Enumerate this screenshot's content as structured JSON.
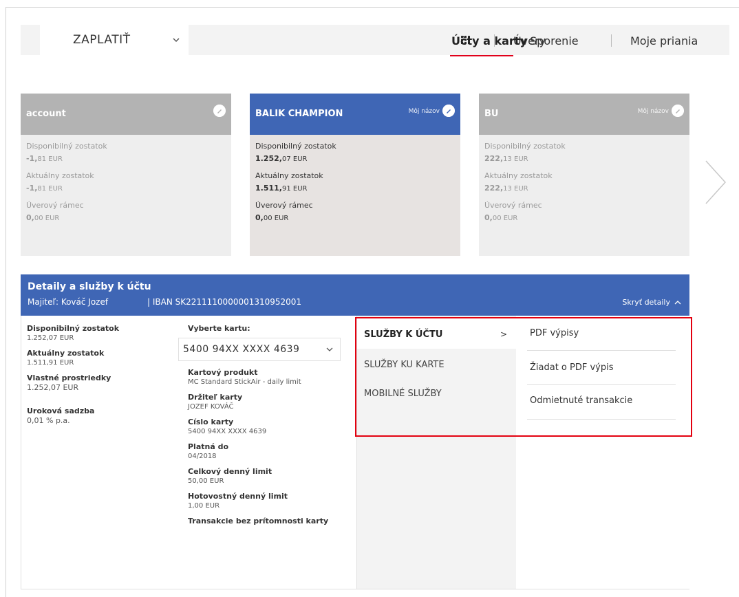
{
  "topbar": {
    "pay_label": "ZAPLATIŤ",
    "nav": [
      {
        "label": "Úvery"
      },
      {
        "label": "Účty a karty",
        "active": true
      },
      {
        "label": "Sporenie"
      },
      {
        "label": "Moje priania"
      }
    ]
  },
  "cards": [
    {
      "title": "account",
      "my_name": "",
      "available_label": "Disponibilný zostatok",
      "available_int": "-1,",
      "available_dec": "81 EUR",
      "current_label": "Aktuálny zostatok",
      "current_int": "-1,",
      "current_dec": "81 EUR",
      "credit_label": "Úverový rámec",
      "credit_int": "0,",
      "credit_dec": "00 EUR"
    },
    {
      "title": "BALIK CHAMPION",
      "my_name": "Môj názov",
      "available_label": "Disponibilný zostatok",
      "available_int": "1.252,",
      "available_dec": "07 EUR",
      "current_label": "Aktuálny zostatok",
      "current_int": "1.511,",
      "current_dec": "91 EUR",
      "credit_label": "Úverový rámec",
      "credit_int": "0,",
      "credit_dec": "00 EUR"
    },
    {
      "title": "BU",
      "my_name": "Môj názov",
      "available_label": "Disponibilný zostatok",
      "available_int": "222,",
      "available_dec": "13 EUR",
      "current_label": "Aktuálny zostatok",
      "current_int": "222,",
      "current_dec": "13 EUR",
      "credit_label": "Úverový rámec",
      "credit_int": "0,",
      "credit_dec": "00 EUR"
    }
  ],
  "detail": {
    "title": "Detaily a služby k účtu",
    "owner": "Majiteľ: Kováč Jozef",
    "iban": "| IBAN SK2211110000001310952001",
    "hide_label": "Skryť detaily",
    "account": {
      "available_label": "Disponibilný zostatok",
      "available_value": "1.252,07 EUR",
      "current_label": "Aktuálny zostatok",
      "current_value": "1.511,91 EUR",
      "own_label": "Vlastné prostriedky",
      "own_value": "1.252,07 EUR",
      "rate_label": "Uroková sadzba",
      "rate_value": "0,01 % p.a."
    },
    "card": {
      "select_label": "Vyberte kartu:",
      "select_value": "5400 94XX XXXX 4639",
      "product_label": "Kartový produkt",
      "product_value": "MC Standard StickAir - daily limit",
      "holder_label": "Držiteľ karty",
      "holder_value": "JOZEF KOVÁČ",
      "number_label": "Císlo karty",
      "number_value": "5400 94XX XXXX 4639",
      "valid_label": "Platná do",
      "valid_value": "04/2018",
      "daily_label": "Celkový denný limit",
      "daily_value": "50,00 EUR",
      "cash_label": "Hotovostný denný limit",
      "cash_value": "1,00 EUR",
      "cnp_label": "Transakcie bez prítomnosti karty"
    },
    "services": {
      "tabs": [
        "SLUŽBY K ÚČTU",
        "SLUŽBY KU KARTE",
        "MOBILNÉ SLUŽBY"
      ],
      "links": [
        "PDF výpisy",
        "Žiadat o PDF výpis",
        "Odmietnuté transakcie"
      ]
    }
  },
  "colors": {
    "brand_blue": "#3f66b5",
    "accent_red": "#e1001a",
    "card_gray": "#b3b3b3"
  }
}
